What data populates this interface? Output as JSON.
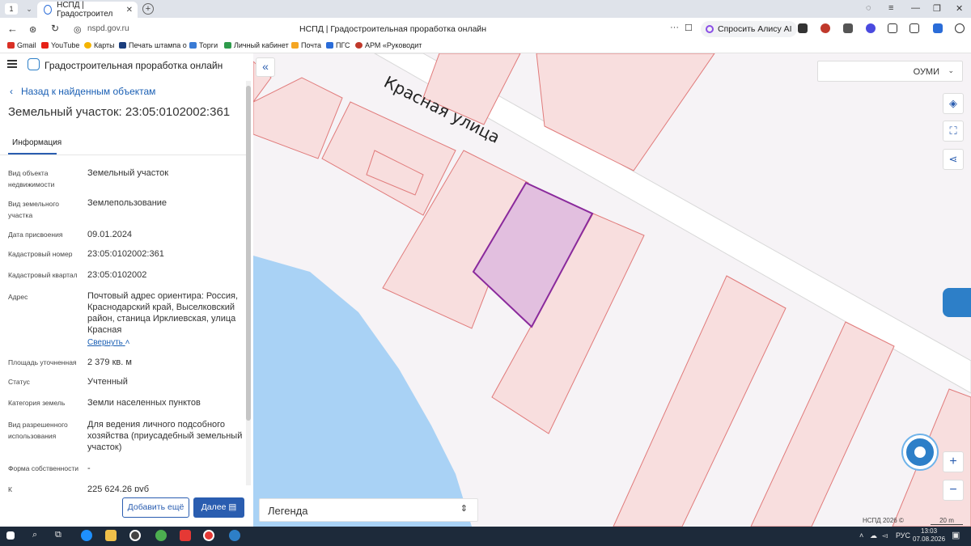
{
  "browser": {
    "tab_number": "1",
    "tab_title": "НСПД | Градостроител",
    "url": "nspd.gov.ru",
    "page_title": "НСПД | Градостроительная проработка онлайн",
    "alice_label": "Спросить Алису AI",
    "bookmarks": [
      "Gmail",
      "YouTube",
      "Карты",
      "Печать штампа о",
      "Торги",
      "Личный кабинет",
      "Почта",
      "ПГС",
      "АРМ «Руководит"
    ]
  },
  "app": {
    "title": "Градостроительная проработка онлайн"
  },
  "panel": {
    "back_label": "Назад к найденным объектам",
    "title": "Земельный участок: 23:05:0102002:361",
    "tab_info": "Информация",
    "fields": [
      {
        "label": "Вид объекта недвижимости",
        "value": "Земельный участок"
      },
      {
        "label": "Вид земельного участка",
        "value": "Землепользование"
      },
      {
        "label": "Дата присвоения",
        "value": "09.01.2024"
      },
      {
        "label": "Кадастровый номер",
        "value": "23:05:0102002:361"
      },
      {
        "label": "Кадастровый квартал",
        "value": "23:05:0102002"
      },
      {
        "label": "Адрес",
        "value": "Почтовый адрес ориентира: Россия, Краснодарский край, Выселковский район, станица Ирклиевская, улица Красная"
      },
      {
        "label": "Площадь уточненная",
        "value": "2 379 кв. м"
      },
      {
        "label": "Статус",
        "value": "Учтенный"
      },
      {
        "label": "Категория земель",
        "value": "Земли населенных пунктов"
      },
      {
        "label": "Вид разрешенного использования",
        "value": "Для ведения личного подсобного хозяйства (приусадебный земельный участок)"
      },
      {
        "label": "Форма собственности",
        "value": "-"
      },
      {
        "label": "К",
        "value": "225 624,26 руб"
      }
    ],
    "collapse_link": "Свернуть",
    "add_more": "Добавить ещё",
    "next": "Далее"
  },
  "map": {
    "street_label": "Красная улица",
    "layer_select": "ОУМИ",
    "legend": "Легенда",
    "credit": "НСПД 2026 ©",
    "scale": "20 m"
  },
  "taskbar": {
    "lang": "РУС",
    "time": "13:03",
    "date": "07.08.2026"
  }
}
